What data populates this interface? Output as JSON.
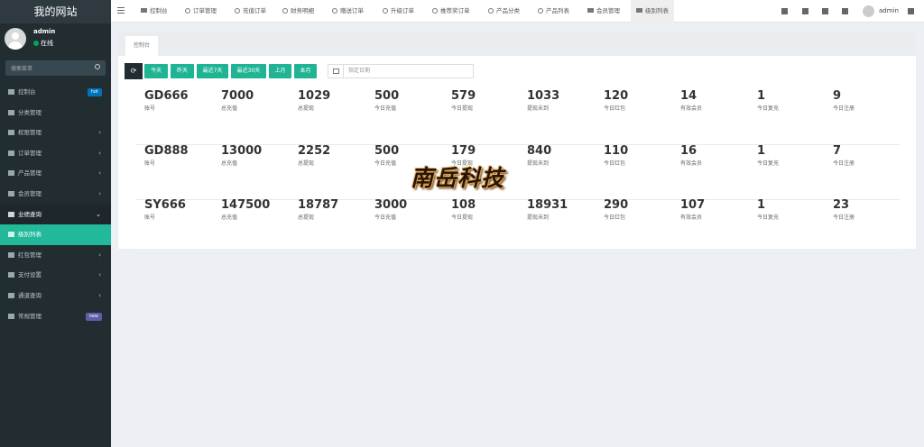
{
  "app": {
    "title": "我的网站"
  },
  "user": {
    "name": "admin",
    "status": "在线"
  },
  "sidebar": {
    "search_placeholder": "搜索菜单",
    "items": [
      {
        "label": "控制台",
        "badge": "hot",
        "badge_color": "#0073b7"
      },
      {
        "label": "分类管理"
      },
      {
        "label": "权限管理",
        "arrow": "‹"
      },
      {
        "label": "订单管理",
        "arrow": "‹"
      },
      {
        "label": "产品管理",
        "arrow": "‹"
      },
      {
        "label": "会员管理",
        "arrow": "‹"
      },
      {
        "label": "业绩查询",
        "arrow": "⌄"
      },
      {
        "label": "级别列表"
      },
      {
        "label": "红包管理",
        "arrow": "‹"
      },
      {
        "label": "支付设置",
        "arrow": "‹"
      },
      {
        "label": "通道查询",
        "arrow": "‹"
      },
      {
        "label": "常规管理",
        "badge": "new",
        "badge_color": "#605ca8"
      }
    ]
  },
  "topbar": {
    "tabs": [
      "控制台",
      "订单管理",
      "充值订单",
      "财务明细",
      "赠送订单",
      "升级订单",
      "推荐奖订单",
      "产品分类",
      "产品列表",
      "会员管理",
      "级别列表"
    ],
    "user": "admin"
  },
  "content": {
    "tab_label": "控制台",
    "filters": [
      "今天",
      "昨天",
      "最近7天",
      "最近30天",
      "上月",
      "本月"
    ],
    "date_placeholder": "指定日期",
    "stat_labels": [
      "账号",
      "总充值",
      "总提现",
      "今日充值",
      "今日提现",
      "提现未到",
      "今日红包",
      "有效会员",
      "今日复充",
      "今日注册"
    ],
    "rows": [
      {
        "values": [
          "GD666",
          "7000",
          "1029",
          "500",
          "579",
          "1033",
          "120",
          "14",
          "1",
          "9"
        ]
      },
      {
        "values": [
          "GD888",
          "13000",
          "2252",
          "500",
          "179",
          "840",
          "110",
          "16",
          "1",
          "7"
        ]
      },
      {
        "values": [
          "SY666",
          "147500",
          "18787",
          "3000",
          "108",
          "18931",
          "290",
          "107",
          "1",
          "23"
        ]
      }
    ]
  },
  "watermark": "南岳科技",
  "colors": {
    "accent": "#1fb494",
    "sidebar": "#222d32"
  }
}
